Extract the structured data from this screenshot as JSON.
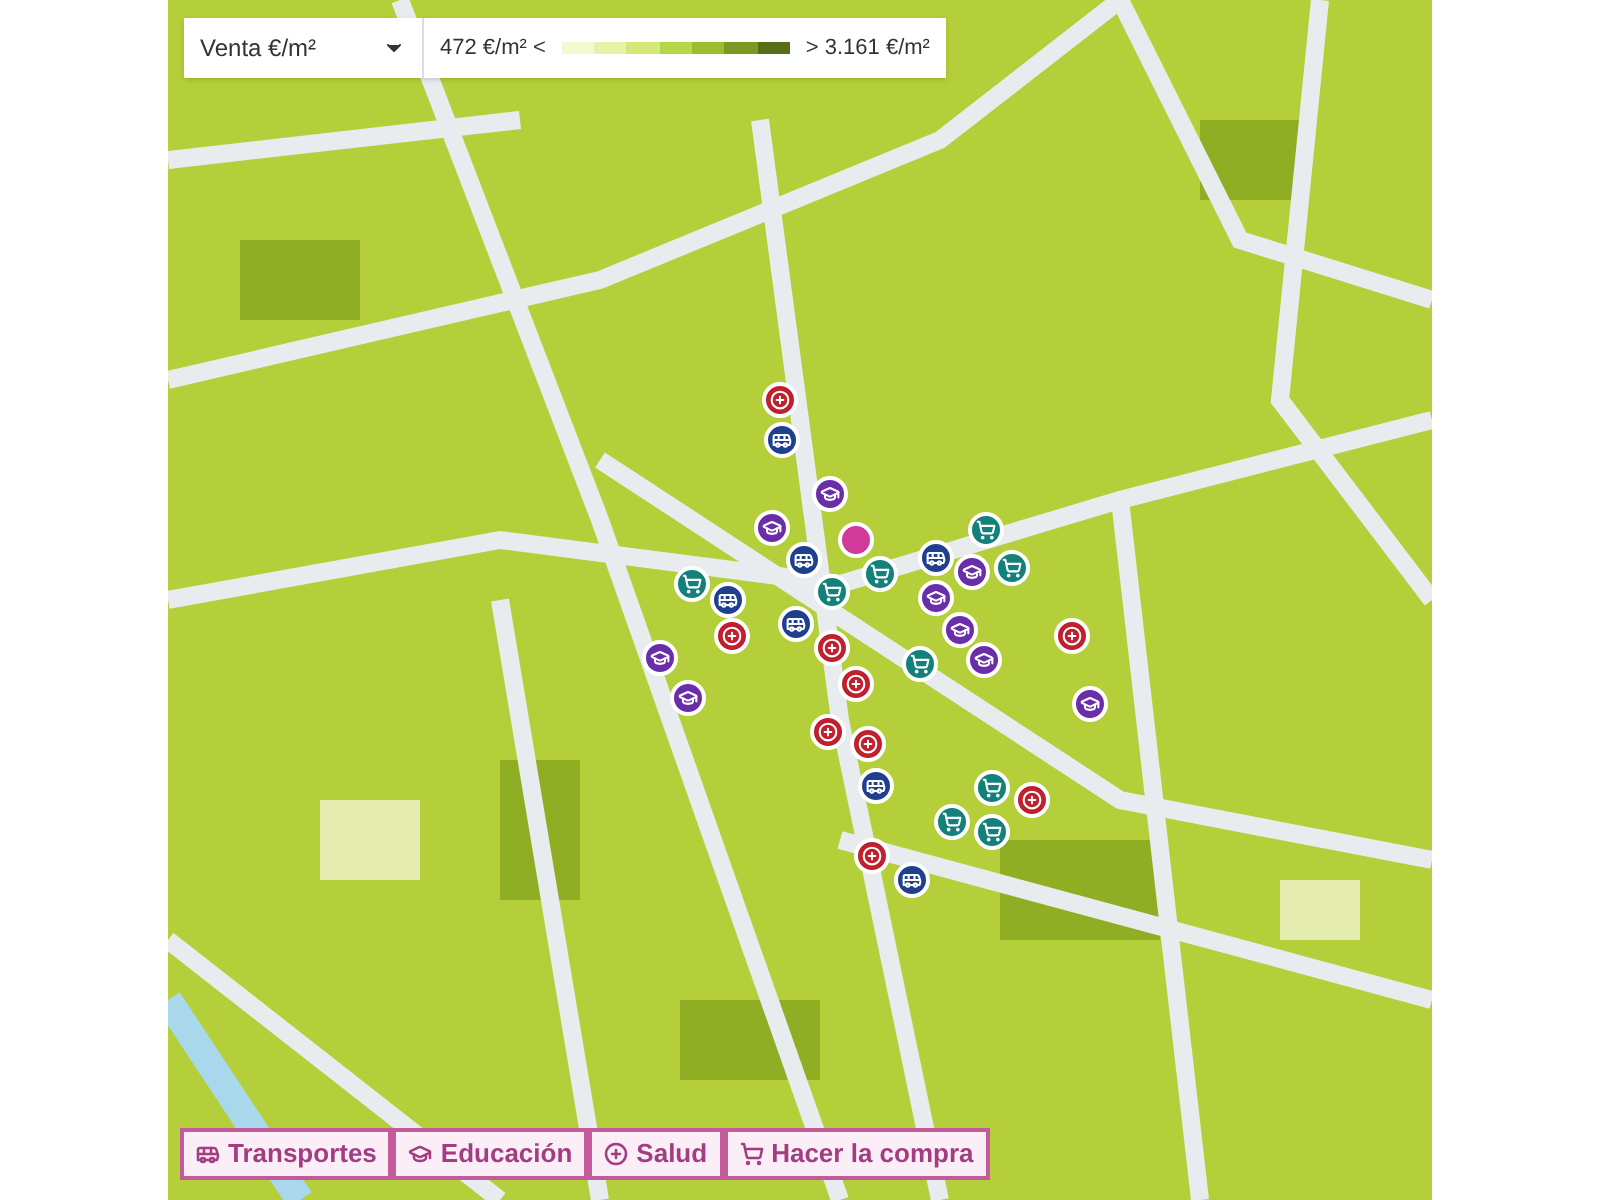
{
  "price_selector": {
    "value": "Venta €/m²"
  },
  "legend": {
    "min_label": "472 €/m² <",
    "max_label": "> 3.161 €/m²"
  },
  "filters": [
    {
      "kind": "transport",
      "label": "Transportes"
    },
    {
      "kind": "education",
      "label": "Educación"
    },
    {
      "kind": "health",
      "label": "Salud"
    },
    {
      "kind": "shopping",
      "label": "Hacer la compra"
    }
  ]
}
